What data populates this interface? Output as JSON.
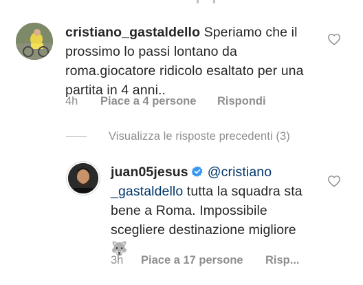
{
  "comments": [
    {
      "username": "cristiano_gastaldello",
      "text": " Speriamo che il prossimo lo passi lontano da roma.giocatore ridicolo esaltato per una partita in 4 anni..",
      "time": "4h",
      "likes": "Piace a 4 persone",
      "reply": "Rispondi",
      "avatar_icon": "avatar-cyclist"
    }
  ],
  "view_replies": "Visualizza le risposte precedenti (3)",
  "reply_comment": {
    "username": "juan05jesus",
    "verified": true,
    "mention": "@cristiano _gastaldello",
    "text": " tutta la squadra sta bene a Roma. Impossibile scegliere destinazione migliore",
    "emoji": "🐺",
    "time": "3h",
    "likes": "Piace a 17 persone",
    "reply": "Risp...",
    "avatar_icon": "avatar-portrait"
  },
  "colors": {
    "text": "#262626",
    "muted": "#8e8e8e",
    "mention": "#00376b",
    "verified": "#3897f0"
  }
}
